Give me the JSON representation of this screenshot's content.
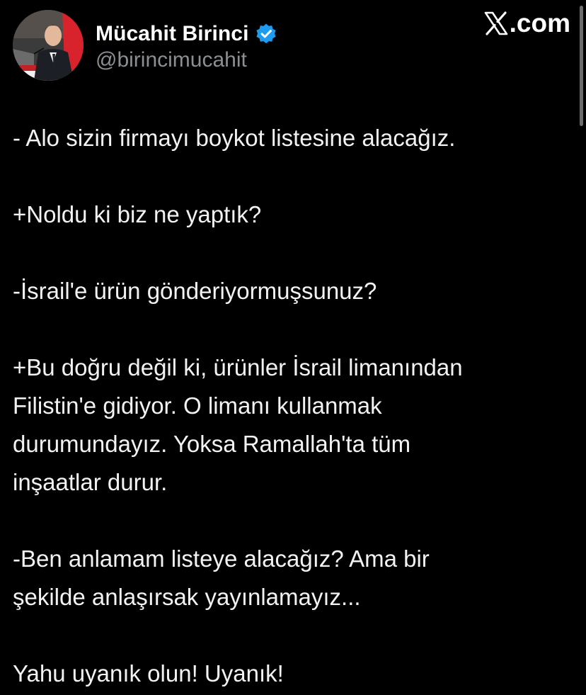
{
  "author": {
    "display_name": "Mücahit Birinci",
    "handle": "@birincimucahit",
    "verified_icon": "verified-badge-icon",
    "avatar_icon": "profile-photo"
  },
  "site": {
    "label": ".com",
    "logo_icon": "x-logo-icon"
  },
  "tweet": {
    "paragraphs": [
      "- Alo sizin firmayı boykot listesine alacağız.",
      "+Noldu ki biz ne yaptık?",
      "-İsrail'e ürün gönderiyormuşsunuz?",
      "+Bu doğru değil ki, ürünler İsrail limanından\nFilistin'e gidiyor. O limanı kullanmak\ndurumundayız. Yoksa Ramallah'ta tüm\ninşaatlar durur.",
      "-Ben anlamam listeye alacağız? Ama bir\nşekilde anlaşırsak yayınlamayız...",
      "Yahu uyanık olun! Uyanık!"
    ]
  },
  "colors": {
    "background": "#000000",
    "text": "#f2f2f2",
    "handle": "#8b8f94",
    "verified": "#1d9bf0",
    "avatar_ring": "#e0232b"
  }
}
